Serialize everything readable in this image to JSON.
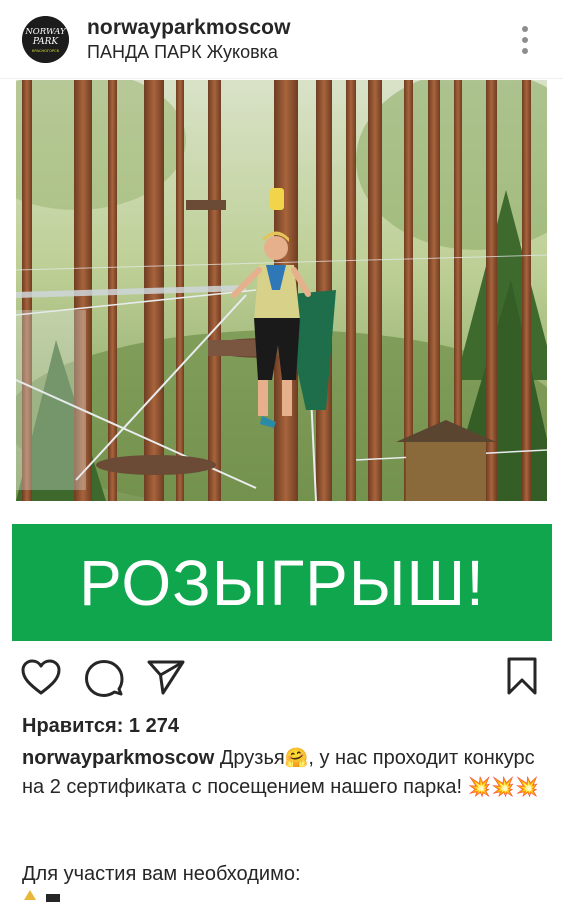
{
  "post": {
    "username": "norwayparkmoscow",
    "location": "ПАНДА ПАРК  Жуковка",
    "avatar_icon": "norway-park-logo",
    "avatar_text": [
      "NORWAY",
      "PARK",
      "КРАСНОГОРСК"
    ],
    "photo_description_icon": "rope-park-photo"
  },
  "banner": {
    "text": "РОЗЫГРЫШ!",
    "color": "#10a64e"
  },
  "actions": {
    "like_icon": "heart-icon",
    "comment_icon": "comment-icon",
    "share_icon": "send-icon",
    "save_icon": "bookmark-icon"
  },
  "likes": {
    "text": "Нравится: 1 274"
  },
  "caption": {
    "username": "norwayparkmoscow",
    "text_part1": " Друзья",
    "emoji1": "🤗",
    "text_part2": ", у нас проходит конкурс на 2 сертификата с посещением нашего парка! ",
    "emoji2": "💥💥💥",
    "text_part3": "Для участия вам необходимо:"
  }
}
